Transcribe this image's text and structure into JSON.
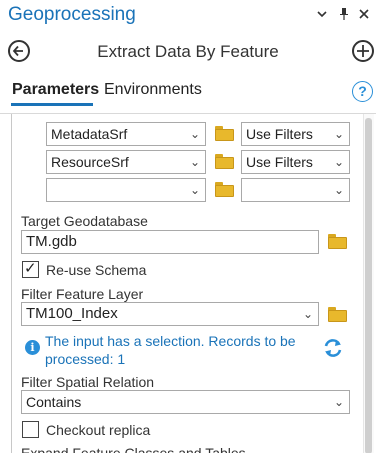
{
  "pane": {
    "title": "Geoprocessing",
    "menu_icon": "chevron-down-icon",
    "pin_icon": "pin-icon",
    "close_icon": "close-icon"
  },
  "tool": {
    "title": "Extract Data By Feature",
    "back_icon": "back-arrow-icon",
    "add_icon": "add-icon"
  },
  "tabs": [
    {
      "label": "Parameters",
      "active": true
    },
    {
      "label": "Environments",
      "active": false
    }
  ],
  "help_icon": "help-icon",
  "help_glyph": "?",
  "feature_rows": [
    {
      "dataset": "MetadataSrf",
      "filter": "Use Filters"
    },
    {
      "dataset": "ResourceSrf",
      "filter": "Use Filters"
    },
    {
      "dataset": "",
      "filter": ""
    }
  ],
  "target_geodatabase": {
    "label": "Target Geodatabase",
    "value": "TM.gdb"
  },
  "reuse_schema": {
    "label": "Re-use Schema",
    "checked": true,
    "mark": "✓"
  },
  "filter_feature_layer": {
    "label": "Filter Feature Layer",
    "value": "TM100_Index"
  },
  "selection_info": {
    "line1": "The input has a selection. Records to be",
    "line2": "processed: 1",
    "icon_glyph": "i"
  },
  "filter_spatial_relation": {
    "label": "Filter Spatial Relation",
    "value": "Contains"
  },
  "checkout_replica": {
    "label": "Checkout replica",
    "checked": false
  },
  "expand_section": {
    "label": "Expand Feature Classes and Tables"
  },
  "colors": {
    "accent": "#1a73b8",
    "folder": "#e8b82c",
    "info": "#2a8fd8"
  }
}
